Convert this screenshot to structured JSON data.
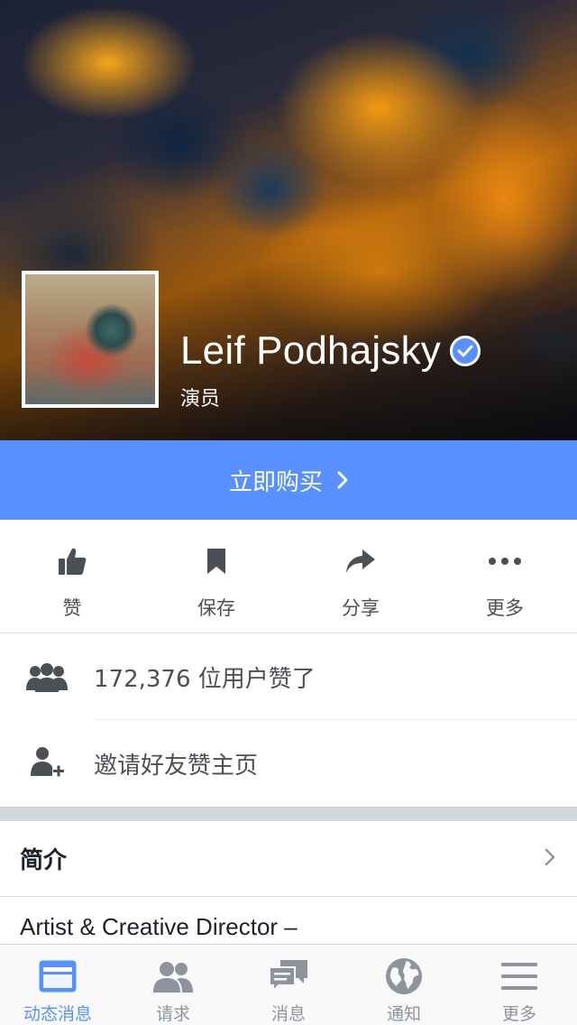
{
  "profile": {
    "name": "Leif Podhajsky",
    "category": "演员",
    "verified": true
  },
  "shop": {
    "label": "立即购买"
  },
  "actions": [
    {
      "id": "like",
      "label": "赞",
      "icon": "thumbs-up-icon"
    },
    {
      "id": "save",
      "label": "保存",
      "icon": "bookmark-icon"
    },
    {
      "id": "share",
      "label": "分享",
      "icon": "share-icon"
    },
    {
      "id": "more",
      "label": "更多",
      "icon": "more-dots-icon"
    }
  ],
  "likes": {
    "text": "172,376 位用户赞了",
    "icon": "people-icon"
  },
  "invite": {
    "text": "邀请好友赞主页",
    "icon": "add-person-icon"
  },
  "about": {
    "title": "简介",
    "body": "Artist & Creative Director –"
  },
  "tabbar": {
    "items": [
      {
        "label": "动态消息",
        "icon": "news-feed-icon",
        "active": true
      },
      {
        "label": "请求",
        "icon": "friend-requests-icon",
        "active": false
      },
      {
        "label": "消息",
        "icon": "messages-icon",
        "active": false
      },
      {
        "label": "通知",
        "icon": "globe-icon",
        "active": false
      },
      {
        "label": "更多",
        "icon": "menu-icon",
        "active": false
      }
    ]
  },
  "colors": {
    "accent": "#5890ff",
    "icon_gray": "#4b4f56",
    "tab_inactive": "#8d949e"
  }
}
